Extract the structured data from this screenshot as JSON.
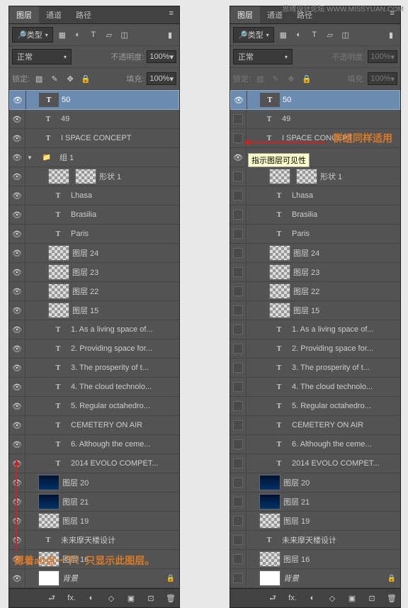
{
  "watermark_site": "思缘设计论坛",
  "watermark_url": "WWW.MISSYUAN.COM",
  "tabs": {
    "layers": "图层",
    "channels": "通道",
    "paths": "路径"
  },
  "filter": {
    "kind": "类型"
  },
  "blend": {
    "mode": "正常",
    "opacity_label": "不透明度:",
    "opacity_val": "100%"
  },
  "lock": {
    "label": "锁定:",
    "fill_label": "填充:",
    "fill_val": "100%"
  },
  "layers": [
    {
      "name": "50",
      "type": "text",
      "indent": 1,
      "selected": true
    },
    {
      "name": "49",
      "type": "text",
      "indent": 1
    },
    {
      "name": "I  SPACE CONCEPT",
      "type": "text",
      "indent": 1
    },
    {
      "name": "组 1",
      "type": "folder",
      "indent": 0,
      "open": true
    },
    {
      "name": "形状 1",
      "type": "checker",
      "indent": 2,
      "shape": true
    },
    {
      "name": "Lhasa",
      "type": "text",
      "indent": 2
    },
    {
      "name": "Brasilia",
      "type": "text",
      "indent": 2
    },
    {
      "name": "Paris",
      "type": "text",
      "indent": 2
    },
    {
      "name": "图层 24",
      "type": "checker",
      "indent": 2
    },
    {
      "name": "图层 23",
      "type": "checker",
      "indent": 2
    },
    {
      "name": "图层 22",
      "type": "checker",
      "indent": 2
    },
    {
      "name": "图层 15",
      "type": "checker",
      "indent": 2
    },
    {
      "name": "1. As a living space of...",
      "type": "text",
      "indent": 2
    },
    {
      "name": "2. Providing space for...",
      "type": "text",
      "indent": 2
    },
    {
      "name": "3. The prosperity of t...",
      "type": "text",
      "indent": 2
    },
    {
      "name": "4. The cloud technolo...",
      "type": "text",
      "indent": 2
    },
    {
      "name": "5. Regular octahedro...",
      "type": "text",
      "indent": 2
    },
    {
      "name": "CEMETERY ON AIR",
      "type": "text",
      "indent": 2
    },
    {
      "name": "6. Although the ceme...",
      "type": "text",
      "indent": 2
    },
    {
      "name": "2014 EVOLO COMPET...",
      "type": "text",
      "indent": 2
    },
    {
      "name": "图层 20",
      "type": "night",
      "indent": 1
    },
    {
      "name": "图层 21",
      "type": "night",
      "indent": 1
    },
    {
      "name": "图层 19",
      "type": "checker",
      "indent": 1
    },
    {
      "name": "未来摩天楼设计",
      "type": "text",
      "indent": 1
    },
    {
      "name": "图层 16",
      "type": "checker",
      "indent": 1
    },
    {
      "name": "背景",
      "type": "white",
      "indent": 1,
      "italic": true,
      "locked": true
    }
  ],
  "annotations": {
    "bottom": "摁着alt点一下！只显示此图层。",
    "group": "群组同样适用",
    "tooltip": "指示图层可见性"
  },
  "footer_icons": [
    "GO",
    "fx.",
    "◐",
    "◇",
    "▣",
    "⊡",
    "🗑"
  ]
}
